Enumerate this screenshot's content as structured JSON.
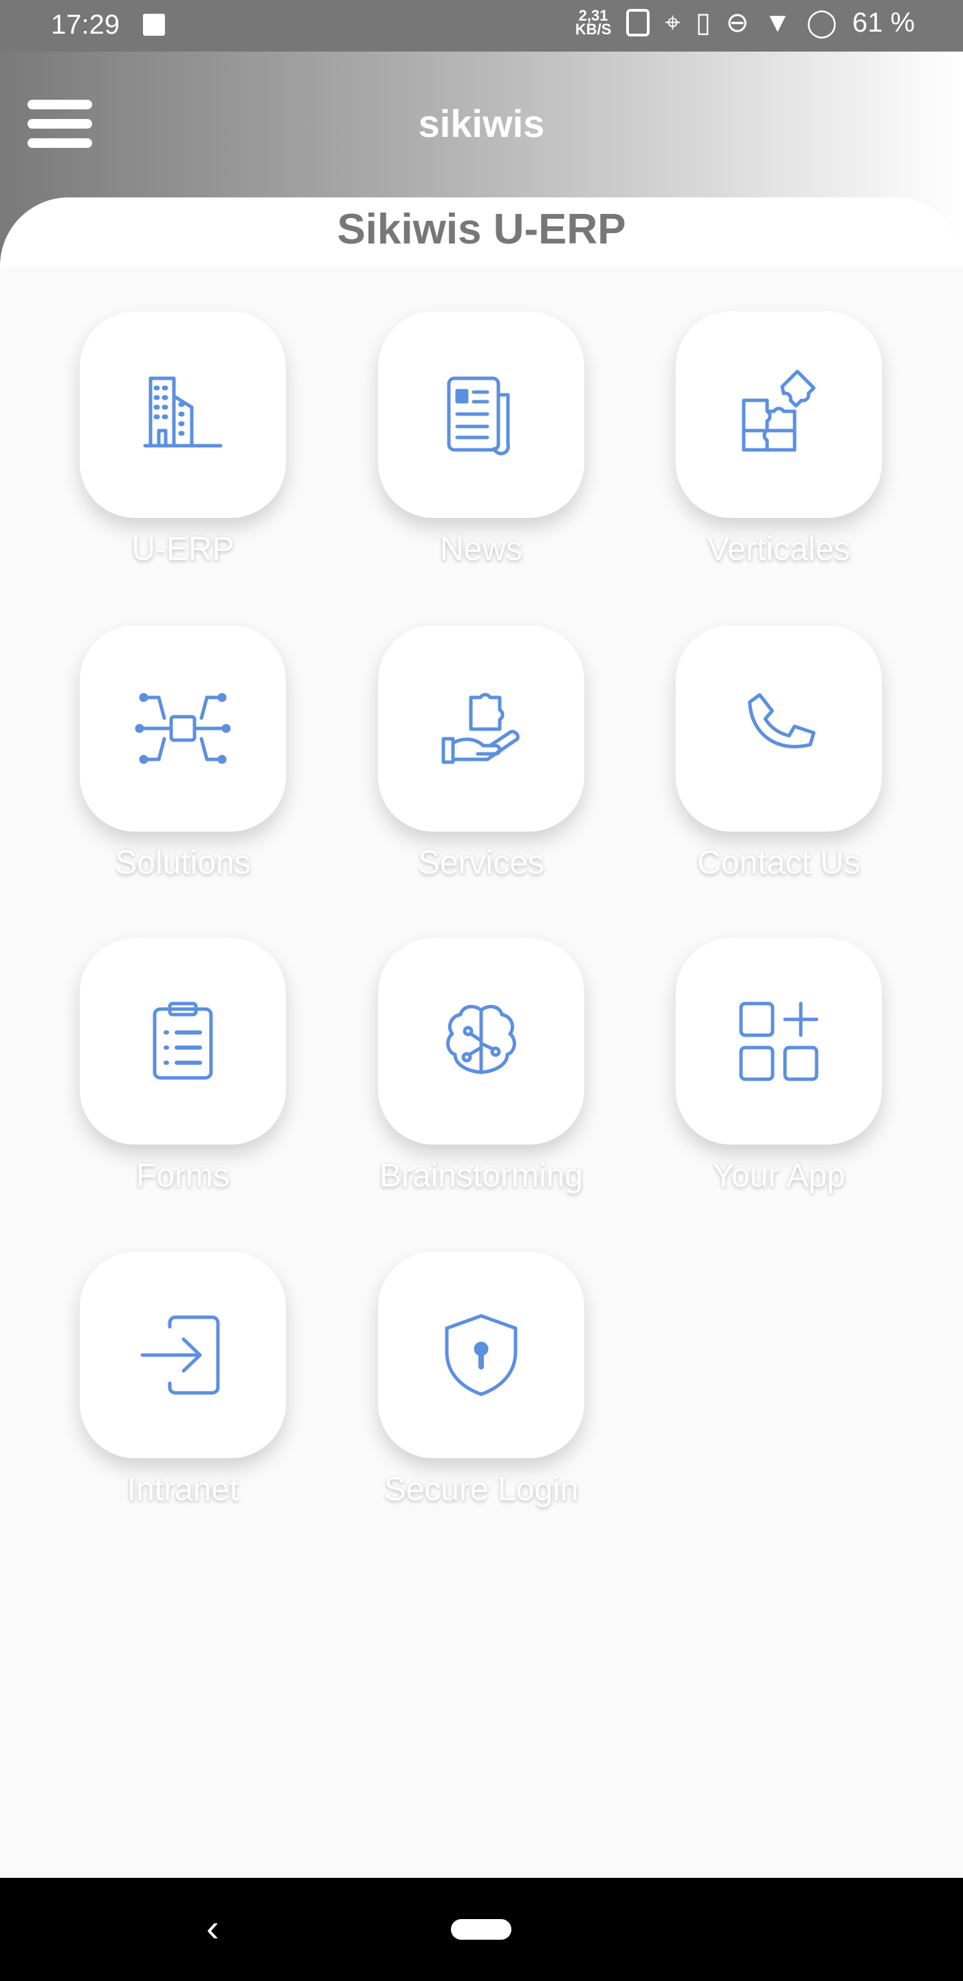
{
  "status_bar": {
    "time": "17:29",
    "speed_value": "2,31",
    "speed_unit": "KB/S",
    "battery": "61 %",
    "icons": [
      "image-icon",
      "nfc-icon",
      "location-icon",
      "vibrate-icon",
      "dnd-icon",
      "wifi-icon",
      "battery-icon"
    ]
  },
  "header": {
    "title": "sikiwis",
    "subtitle": "Sikiwis U-ERP",
    "menu_icon": "hamburger-icon"
  },
  "accent_color": "#5b8fe0",
  "tiles": [
    {
      "label": "U-ERP",
      "icon": "building-icon"
    },
    {
      "label": "News",
      "icon": "newspaper-icon"
    },
    {
      "label": "Verticales",
      "icon": "puzzle-icon"
    },
    {
      "label": "Solutions",
      "icon": "circuit-puzzle-icon"
    },
    {
      "label": "Services",
      "icon": "hand-puzzle-icon"
    },
    {
      "label": "Contact Us",
      "icon": "phone-icon"
    },
    {
      "label": "Forms",
      "icon": "clipboard-icon"
    },
    {
      "label": "Brainstorming",
      "icon": "brain-icon"
    },
    {
      "label": "Your App",
      "icon": "apps-add-icon"
    },
    {
      "label": "Intranet",
      "icon": "login-icon"
    },
    {
      "label": "Secure Login",
      "icon": "shield-lock-icon"
    }
  ],
  "nav": {
    "back": "‹"
  }
}
